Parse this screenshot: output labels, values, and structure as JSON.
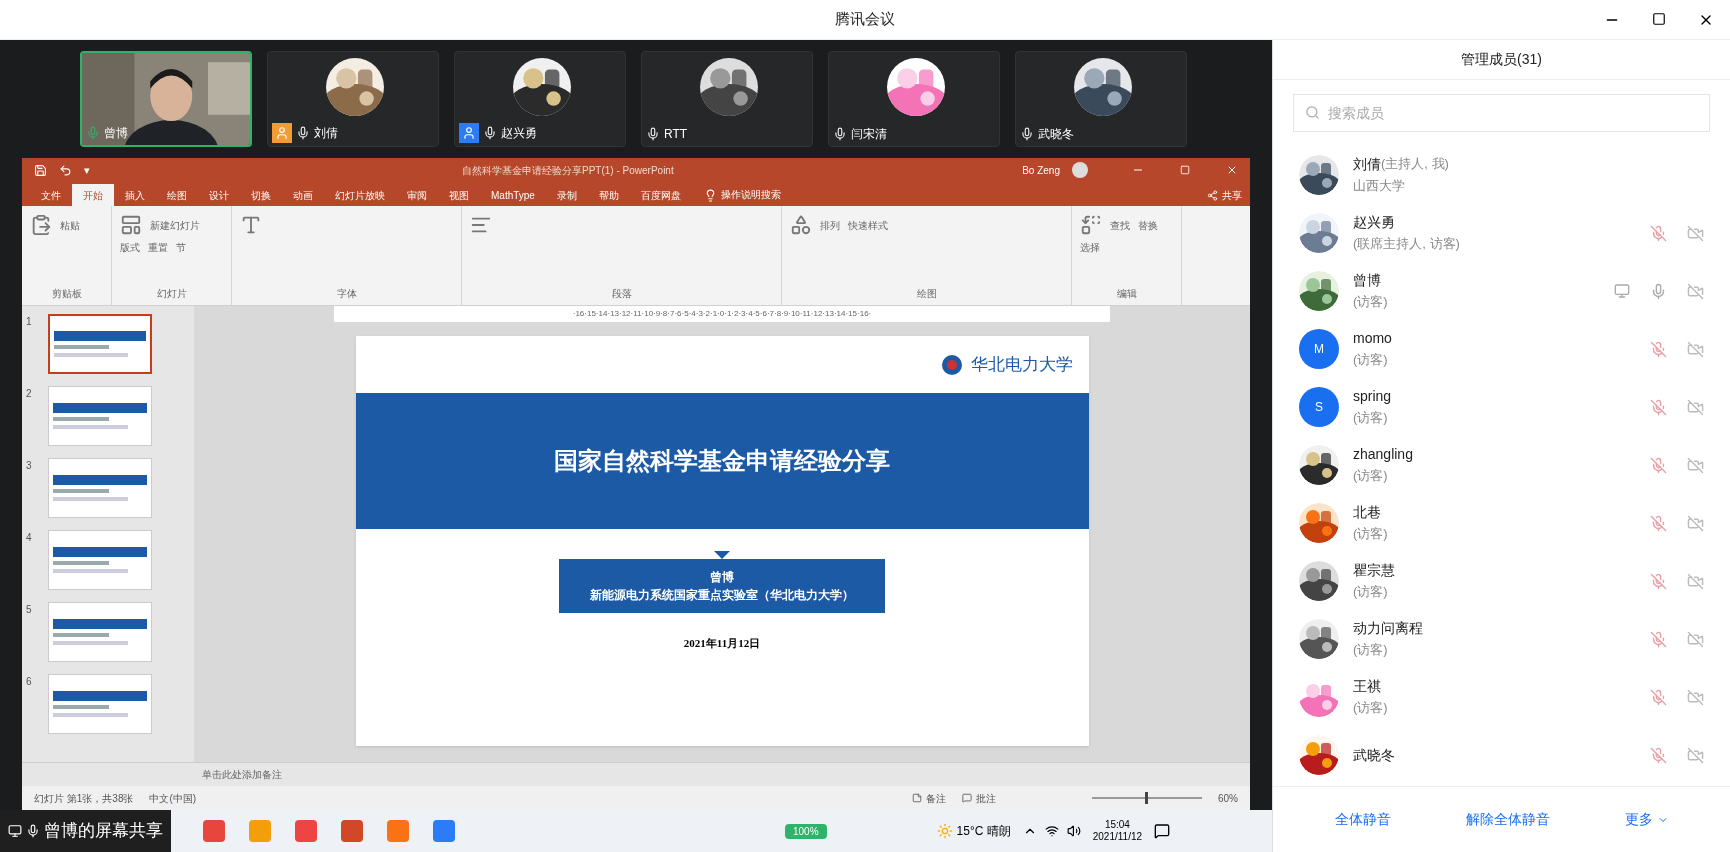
{
  "window": {
    "title": "腾讯会议"
  },
  "video_tiles": [
    {
      "name": "曾博",
      "kind": "camera",
      "selected": true
    },
    {
      "name": "刘倩",
      "kind": "avatar",
      "selected": false,
      "color": "#f39c34"
    },
    {
      "name": "赵兴勇",
      "kind": "avatar",
      "selected": false,
      "color": "#2b7cf6"
    },
    {
      "name": "RTT",
      "kind": "avatar",
      "selected": false
    },
    {
      "name": "闫宋清",
      "kind": "avatar",
      "selected": false
    },
    {
      "name": "武晓冬",
      "kind": "avatar",
      "selected": false
    }
  ],
  "powerpoint": {
    "quick_access": "▾",
    "title": "自然科学基金申请经验分享PPT(1) - PowerPoint",
    "user": "Bo Zeng",
    "tabs": [
      {
        "label": "文件",
        "selected": false
      },
      {
        "label": "开始",
        "selected": true
      },
      {
        "label": "插入",
        "selected": false
      },
      {
        "label": "绘图",
        "selected": false
      },
      {
        "label": "设计",
        "selected": false
      },
      {
        "label": "切换",
        "selected": false
      },
      {
        "label": "动画",
        "selected": false
      },
      {
        "label": "幻灯片放映",
        "selected": false
      },
      {
        "label": "审阅",
        "selected": false
      },
      {
        "label": "视图",
        "selected": false
      },
      {
        "label": "MathType",
        "selected": false
      },
      {
        "label": "录制",
        "selected": false
      },
      {
        "label": "帮助",
        "selected": false
      },
      {
        "label": "百度网盘",
        "selected": false
      }
    ],
    "tell_me": "操作说明搜索",
    "share": "共享",
    "ribbon_groups": [
      {
        "label": "剪贴板",
        "buttons": [
          "粘贴"
        ]
      },
      {
        "label": "幻灯片",
        "buttons": [
          "新建幻灯片",
          "版式",
          "重置",
          "节"
        ]
      },
      {
        "label": "字体"
      },
      {
        "label": "段落"
      },
      {
        "label": "绘图",
        "buttons": [
          "排列",
          "快速样式"
        ]
      },
      {
        "label": "编辑",
        "buttons": [
          "查找",
          "替换",
          "选择"
        ]
      }
    ],
    "ruler": "·16·15·14·13·12·11·10·9·8·7·6·5·4·3·2·1·0·1·2·3·4·5·6·7·8·9·10·11·12·13·14·15·16·",
    "thumbnails": [
      {
        "number": "1",
        "selected": true
      },
      {
        "number": "2",
        "selected": false
      },
      {
        "number": "3",
        "selected": false
      },
      {
        "number": "4",
        "selected": false
      },
      {
        "number": "5",
        "selected": false
      },
      {
        "number": "6",
        "selected": false
      }
    ],
    "slide": {
      "logo": "华北电力大学",
      "title": "国家自然科学基金申请经验分享",
      "presenter": "曾博",
      "affiliation": "新能源电力系统国家重点实验室（华北电力大学）",
      "date": "2021年11月12日"
    },
    "notes_placeholder": "单击此处添加备注",
    "status": {
      "slide_count": "幻灯片 第1张，共38张",
      "language": "中文(中国)",
      "notes": "备注",
      "comments": "批注",
      "zoom": "60%",
      "level": 0.5
    }
  },
  "taskbar": {
    "share_label": "曾博的屏幕共享",
    "battery": "100%",
    "weather": "15°C 晴朗",
    "time": "15:04",
    "date": "2021/11/12"
  },
  "members": {
    "title": "管理成员(31)",
    "search": {
      "placeholder": "搜索成员"
    },
    "list": [
      {
        "name": "刘倩",
        "suffix": "(主持人, 我)",
        "line2": "山西大学",
        "controls": false
      },
      {
        "name": "赵兴勇",
        "line2": "(联席主持人, 访客)",
        "controls": true,
        "sharing": false,
        "mic_muted": true
      },
      {
        "name": "曾博",
        "line2": "(访客)",
        "controls": true,
        "sharing": true,
        "mic_muted": false
      },
      {
        "name": "momo",
        "line2": "(访客)",
        "kind": "letter",
        "initial": "M",
        "controls": true,
        "sharing": false,
        "mic_muted": true
      },
      {
        "name": "spring",
        "line2": "(访客)",
        "kind": "letter",
        "initial": "S",
        "controls": true,
        "sharing": false,
        "mic_muted": true
      },
      {
        "name": "zhangling",
        "line2": "(访客)",
        "controls": true,
        "sharing": false,
        "mic_muted": true
      },
      {
        "name": "北巷",
        "line2": "(访客)",
        "controls": true,
        "sharing": false,
        "mic_muted": true
      },
      {
        "name": "瞿宗慧",
        "line2": "(访客)",
        "controls": true,
        "sharing": false,
        "mic_muted": true
      },
      {
        "name": "动力问离程",
        "line2": "(访客)",
        "controls": true,
        "sharing": false,
        "mic_muted": true
      },
      {
        "name": "王祺",
        "line2": "(访客)",
        "controls": true,
        "sharing": false,
        "mic_muted": true
      },
      {
        "name": "武晓冬",
        "controls": true,
        "sharing": false,
        "mic_muted": true
      }
    ],
    "buttons": [
      "全体静音",
      "解除全体静音",
      "更多"
    ]
  }
}
